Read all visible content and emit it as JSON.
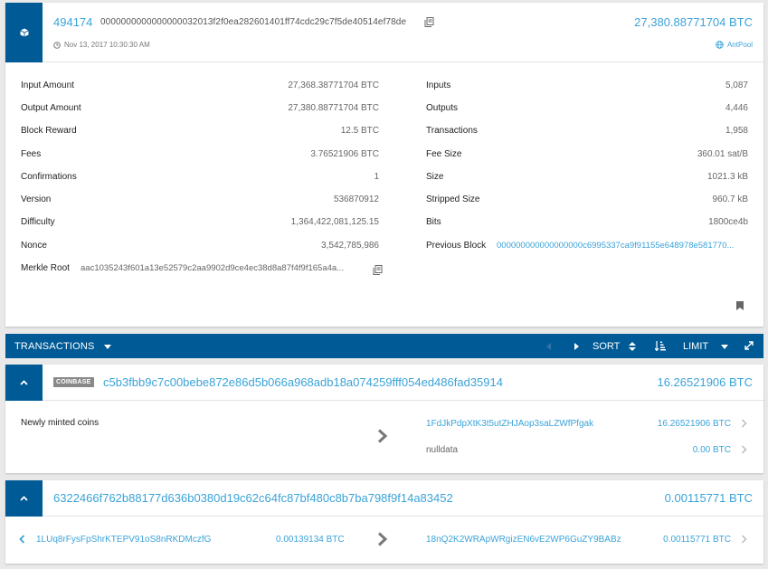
{
  "block": {
    "height": "494174",
    "hash": "0000000000000000032013f2f0ea282601401ff74cdc29c7f5de40514ef78de",
    "time": "Nov 13, 2017 10:30:30 AM",
    "amount": "27,380.88771704 BTC",
    "pool": "AntPool",
    "left_stats": [
      {
        "label": "Input Amount",
        "value": "27,368.38771704 BTC"
      },
      {
        "label": "Output Amount",
        "value": "27,380.88771704 BTC"
      },
      {
        "label": "Block Reward",
        "value": "12.5 BTC"
      },
      {
        "label": "Fees",
        "value": "3.76521906 BTC"
      },
      {
        "label": "Confirmations",
        "value": "1"
      },
      {
        "label": "Version",
        "value": "536870912"
      },
      {
        "label": "Difficulty",
        "value": "1,364,422,081,125.15"
      },
      {
        "label": "Nonce",
        "value": "3,542,785,986"
      }
    ],
    "merkle_label": "Merkle Root",
    "merkle_value": "aac1035243f601a13e52579c2aa9902d9ce4ec38d8a87f4f9f165a4a...",
    "right_stats": [
      {
        "label": "Inputs",
        "value": "5,087"
      },
      {
        "label": "Outputs",
        "value": "4,446"
      },
      {
        "label": "Transactions",
        "value": "1,958"
      },
      {
        "label": "Fee Size",
        "value": "360.01 sat/B"
      },
      {
        "label": "Size",
        "value": "1021.3 kB"
      },
      {
        "label": "Stripped Size",
        "value": "960.7 kB"
      },
      {
        "label": "Bits",
        "value": "1800ce4b"
      }
    ],
    "prev_label": "Previous Block",
    "prev_value": "000000000000000000c6995337ca9f91155e648978e581770..."
  },
  "tx_bar": {
    "title": "TRANSACTIONS",
    "sort_label": "SORT",
    "limit_label": "LIMIT"
  },
  "transactions": [
    {
      "badge": "COINBASE",
      "hash": "c5b3fbb9c7c00bebe872e86d5b066a968adb18a074259fff054ed486fad35914",
      "amount": "16.26521906 BTC",
      "input_text": "Newly minted coins",
      "outputs": [
        {
          "address": "1FdJkPdpXtK3t5utZHJAop3saLZWfPfgak",
          "amount": "16.26521906 BTC"
        },
        {
          "address": "nulldata",
          "amount": "0.00 BTC"
        }
      ]
    },
    {
      "hash": "6322466f762b88177d636b0380d19c62c64fc87bf480c8b7ba798f9f14a83452",
      "amount": "0.00115771 BTC",
      "input_address": "1LUq8rFysFpShrKTEPV91oS8nRKDMczfG",
      "input_amount": "0.00139134 BTC",
      "outputs": [
        {
          "address": "18nQ2K2WRApWRgizEN6vE2WP6GuZY9BABz",
          "amount": "0.00115771 BTC"
        }
      ]
    }
  ],
  "colors": {
    "primary": "#005a96",
    "link": "#3aa3d8"
  }
}
